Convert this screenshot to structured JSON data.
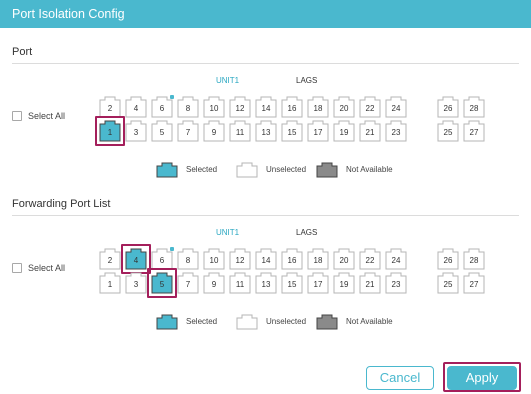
{
  "window": {
    "title": "Port Isolation Config"
  },
  "colors": {
    "accent": "#4ab8ce",
    "highlight": "#a41f5b",
    "not_available": "#8a8a8a"
  },
  "sections": [
    {
      "title": "Port",
      "tabs": {
        "unit": "UNIT1",
        "lags": "LAGS"
      },
      "select_all": "Select All",
      "top_row": [
        "2",
        "4",
        "6",
        "8",
        "10",
        "12",
        "14",
        "16",
        "18",
        "20",
        "22",
        "24",
        "26",
        "28"
      ],
      "bottom_row": [
        "1",
        "3",
        "5",
        "7",
        "9",
        "11",
        "13",
        "15",
        "17",
        "19",
        "21",
        "23",
        "25",
        "27"
      ],
      "selected": [
        "1"
      ],
      "dot_on": [
        "6"
      ],
      "highlighted": [
        "1"
      ]
    },
    {
      "title": "Forwarding Port List",
      "tabs": {
        "unit": "UNIT1",
        "lags": "LAGS"
      },
      "select_all": "Select All",
      "top_row": [
        "2",
        "4",
        "6",
        "8",
        "10",
        "12",
        "14",
        "16",
        "18",
        "20",
        "22",
        "24",
        "26",
        "28"
      ],
      "bottom_row": [
        "1",
        "3",
        "5",
        "7",
        "9",
        "11",
        "13",
        "15",
        "17",
        "19",
        "21",
        "23",
        "25",
        "27"
      ],
      "selected": [
        "4",
        "5"
      ],
      "dot_on": [
        "6"
      ],
      "highlighted": [
        "4",
        "5"
      ]
    }
  ],
  "legend": {
    "selected": "Selected",
    "unselected": "Unselected",
    "not_available": "Not Available"
  },
  "buttons": {
    "cancel": "Cancel",
    "apply": "Apply"
  }
}
